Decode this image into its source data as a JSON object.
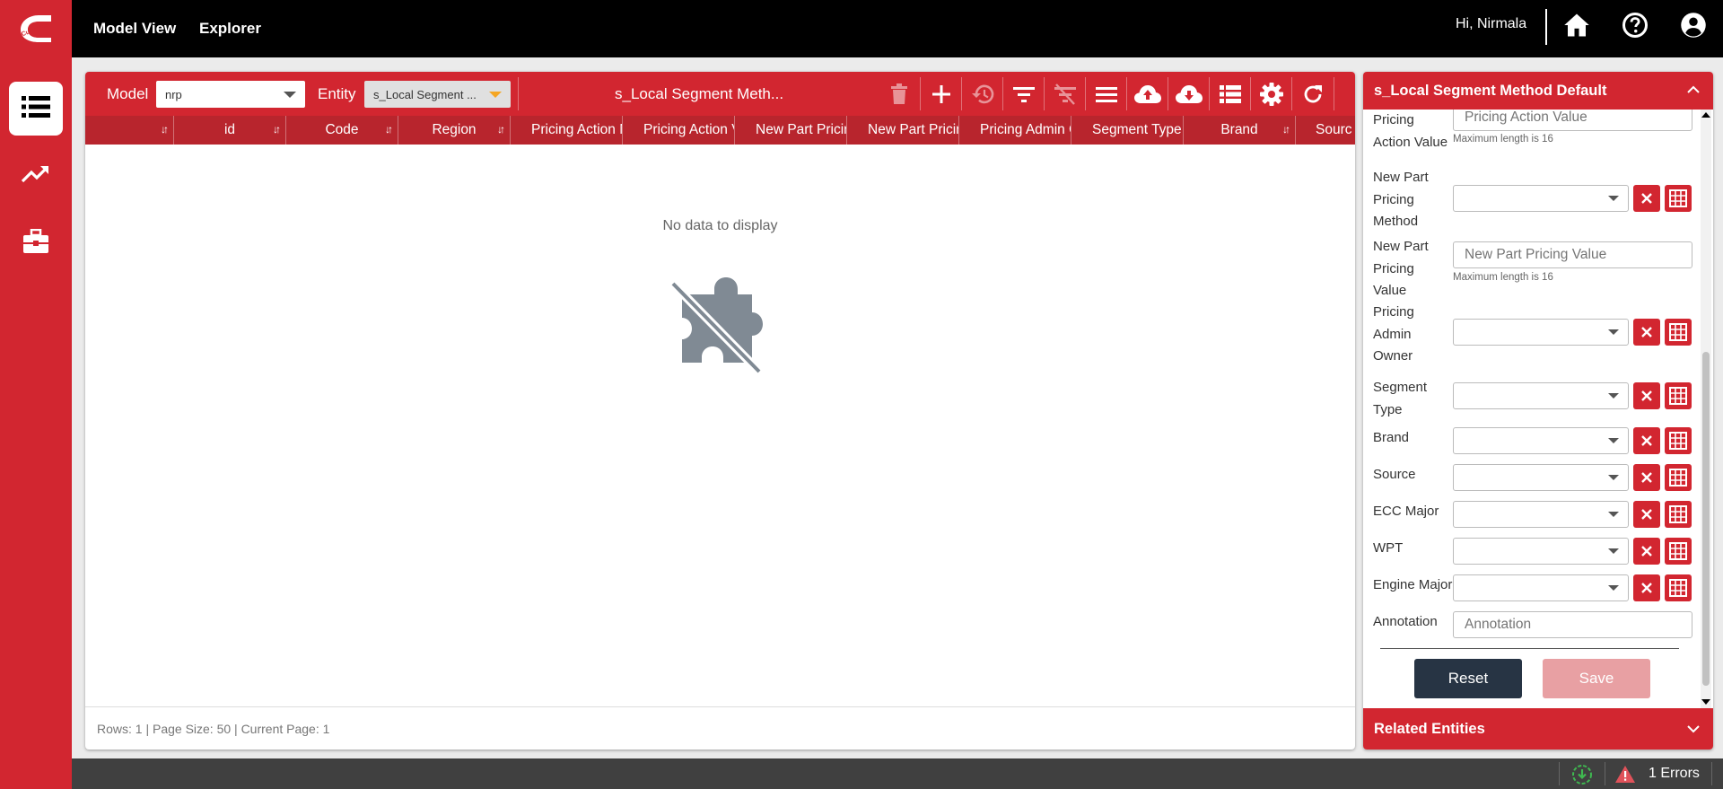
{
  "header": {
    "logo_text": "Cummins",
    "nav": [
      "Model View",
      "Explorer"
    ],
    "greeting": "Hi, Nirmala",
    "icons": [
      "home-icon",
      "help-icon",
      "user-account-icon"
    ]
  },
  "rail": {
    "items": [
      {
        "icon": "list-icon",
        "active": true
      },
      {
        "icon": "trending-up-icon",
        "active": false
      },
      {
        "icon": "briefcase-icon",
        "active": false
      }
    ]
  },
  "toolbar": {
    "model_label": "Model",
    "model_value": "nrp",
    "entity_label": "Entity",
    "entity_value": "s_Local Segment ...",
    "title": "s_Local Segment Meth...",
    "icons": [
      "delete-icon",
      "add-icon",
      "history-icon",
      "filter-icon",
      "clear-filter-icon",
      "menu-icon",
      "upload-cloud-icon",
      "download-cloud-icon",
      "view-list-icon",
      "settings-icon",
      "refresh-icon"
    ]
  },
  "grid": {
    "columns": [
      "",
      "id",
      "Code",
      "Region",
      "Pricing Action M",
      "Pricing Action V",
      "New Part Pricin",
      "New Part Pricin",
      "Pricing Admin O",
      "Segment Type",
      "Brand",
      "Sourc"
    ],
    "empty_text": "No data to display",
    "footer": "Rows: 1 | Page Size: 50 | Current Page: 1"
  },
  "side": {
    "title": "s_Local Segment Method Default",
    "fields": {
      "pricing_action_value": {
        "label": "Pricing Action Value",
        "placeholder": "Pricing Action Value",
        "hint": "Maximum length is 16"
      },
      "new_part_pricing_method": {
        "label": "New Part Pricing Method"
      },
      "new_part_pricing_value": {
        "label": "New Part Pricing Value",
        "placeholder": "New Part Pricing Value",
        "hint": "Maximum length is 16"
      },
      "pricing_admin_owner": {
        "label": "Pricing Admin Owner"
      },
      "segment_type": {
        "label": "Segment Type"
      },
      "brand": {
        "label": "Brand"
      },
      "source": {
        "label": "Source"
      },
      "ecc_major": {
        "label": "ECC Major"
      },
      "wpt": {
        "label": "WPT"
      },
      "engine_major": {
        "label": "Engine Major"
      },
      "annotation": {
        "label": "Annotation",
        "placeholder": "Annotation"
      }
    },
    "reset_label": "Reset",
    "save_label": "Save",
    "related_label": "Related Entities"
  },
  "status": {
    "errors": "1 Errors"
  },
  "colors": {
    "brand_red": "#d22630",
    "header_dark_red": "#b8252d",
    "reset_navy": "#273444",
    "save_disabled": "#e8a0a3",
    "status_bar": "#404040"
  }
}
